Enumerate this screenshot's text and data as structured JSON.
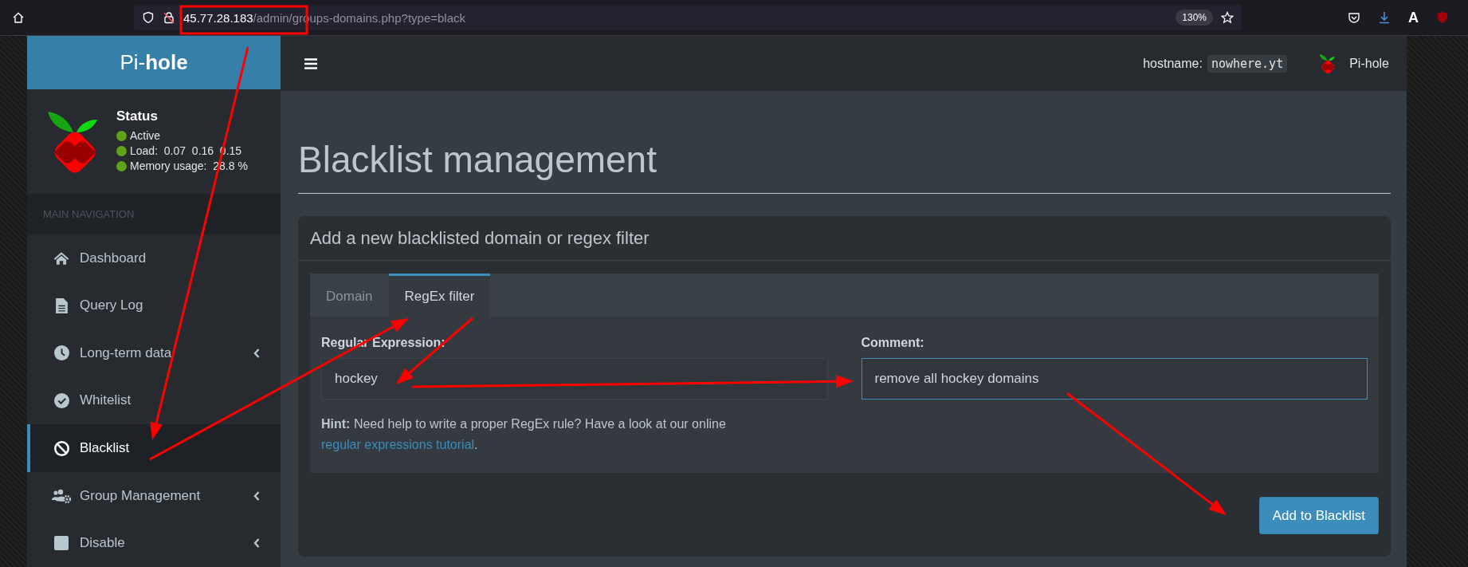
{
  "browser": {
    "url_host": "45.77.28.183",
    "url_path": "/admin/groups-domains.php?type=black",
    "zoom": "130%",
    "extension_letter": "A"
  },
  "sidebar": {
    "logo": "Pi-**hole**",
    "status": {
      "title": "Status",
      "items": [
        "Active",
        "Load:  0.07  0.16  0.15",
        "Memory usage:  28.8 %"
      ]
    },
    "nav_heading": "MAIN NAVIGATION",
    "items": [
      {
        "label": "Dashboard",
        "selected": false,
        "expandable": false
      },
      {
        "label": "Query Log",
        "selected": false,
        "expandable": false
      },
      {
        "label": "Long-term data",
        "selected": false,
        "expandable": true
      },
      {
        "label": "Whitelist",
        "selected": false,
        "expandable": false
      },
      {
        "label": "Blacklist",
        "selected": true,
        "expandable": false
      },
      {
        "label": "Group Management",
        "selected": false,
        "expandable": true
      },
      {
        "label": "Disable",
        "selected": false,
        "expandable": true
      }
    ]
  },
  "topbar": {
    "hostname_label": "hostname:",
    "hostname": "nowhere.yt",
    "brand": "Pi-hole"
  },
  "page_title": "Blacklist management",
  "card": {
    "title": "Add a new blacklisted domain or regex filter",
    "tabs": [
      {
        "label": "Domain",
        "selected": false
      },
      {
        "label": "RegEx filter",
        "selected": true
      }
    ],
    "fields": [
      {
        "label": "Regular Expression:",
        "value": "hockey",
        "focused": false
      },
      {
        "label": "Comment:",
        "value": "remove all hockey domains",
        "focused": true
      }
    ],
    "hint": "**Hint:** Need help to write a proper RegEx rule? Have a look at our online ",
    "hint_link": "regular expressions tutorial",
    "hint_end": ".",
    "button": "Add to Blacklist"
  },
  "annotations": [
    {
      "kind": "box"
    },
    {
      "kind": "arrow"
    },
    {
      "kind": "arrow"
    },
    {
      "kind": "arrow"
    },
    {
      "kind": "arrow"
    },
    {
      "kind": "arrow"
    }
  ]
}
